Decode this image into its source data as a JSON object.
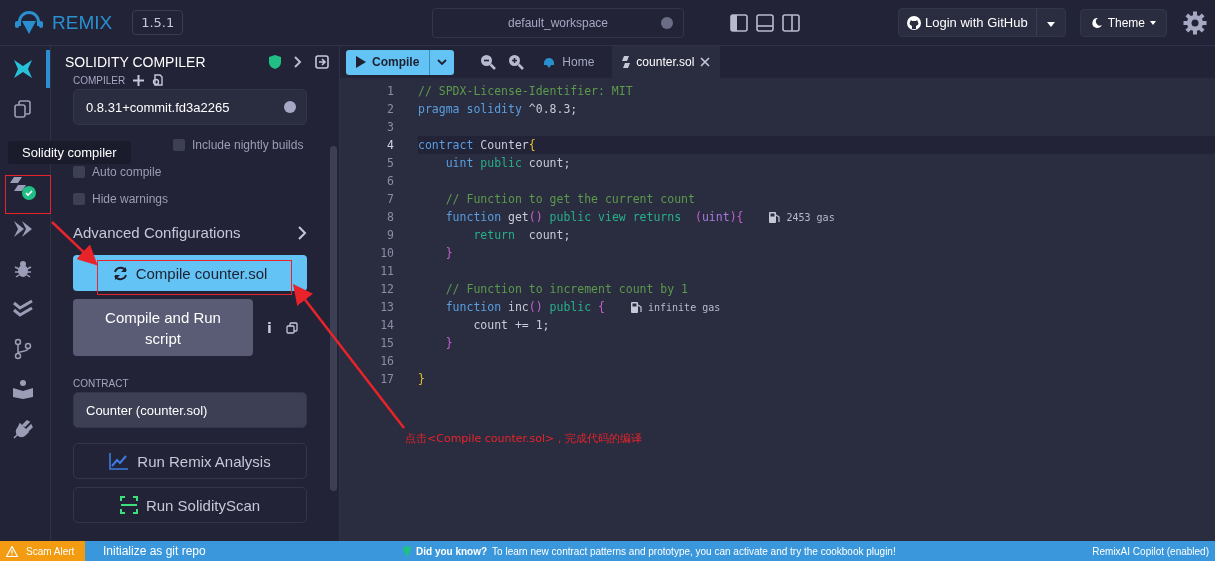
{
  "topbar": {
    "brand": "REMIX",
    "version": "1.5.1",
    "workspace": "default_workspace",
    "login": "Login with GitHub",
    "theme": "Theme"
  },
  "icon_rail": [
    {
      "kind": "ai",
      "selected": true
    },
    {
      "kind": "files",
      "selected": false
    },
    {
      "kind": "compiler",
      "selected": false,
      "compiled": true
    },
    {
      "kind": "deploy",
      "selected": false
    },
    {
      "kind": "debug",
      "selected": false
    },
    {
      "kind": "test",
      "selected": false
    },
    {
      "kind": "git",
      "selected": false
    },
    {
      "kind": "learn",
      "selected": false
    },
    {
      "kind": "plugin",
      "selected": false
    }
  ],
  "tooltip": "Solidity compiler",
  "panel": {
    "title": "SOLIDITY COMPILER",
    "compiler_label": "COMPILER",
    "compiler_version": "0.8.31+commit.fd3a2265",
    "options": [
      {
        "label": "Include nightly builds",
        "checked": false
      },
      {
        "label": "Auto compile",
        "checked": false
      },
      {
        "label": "Hide warnings",
        "checked": false
      }
    ],
    "advanced": "Advanced Configurations",
    "compile_button": "Compile counter.sol",
    "run_script_button": "Compile and Run script",
    "info": "i",
    "contract_label": "CONTRACT",
    "contract": "Counter (counter.sol)",
    "actions": [
      {
        "kind": "analysis",
        "label": "Run Remix Analysis"
      },
      {
        "kind": "scan",
        "label": "Run SolidityScan"
      }
    ]
  },
  "editor": {
    "compile": "Compile",
    "tabs": [
      {
        "kind": "home",
        "label": "Home",
        "selected": false
      },
      {
        "kind": "file",
        "label": "counter.sol",
        "selected": true
      }
    ],
    "lines": [
      {
        "number": "1",
        "current": false,
        "tokens": [
          {
            "kind": "comment",
            "text": "// SPDX-License-Identifier: MIT"
          }
        ]
      },
      {
        "number": "2",
        "current": false,
        "tokens": [
          {
            "kind": "keyword",
            "text": "pragma solidity"
          },
          {
            "kind": "plain",
            "text": " ^0.8.3;"
          }
        ]
      },
      {
        "number": "3",
        "current": false
      },
      {
        "number": "4",
        "current": true,
        "tokens": [
          {
            "kind": "keyword",
            "text": "contract"
          },
          {
            "kind": "plain",
            "text": " Counter"
          },
          {
            "kind": "brace1",
            "text": "{"
          }
        ]
      },
      {
        "number": "5",
        "current": false,
        "tokens": [
          {
            "kind": "keyword",
            "text": "    uint"
          },
          {
            "kind": "modifier",
            "text": " public"
          },
          {
            "kind": "plain",
            "text": " count;"
          }
        ]
      },
      {
        "number": "6",
        "current": false
      },
      {
        "number": "7",
        "current": false,
        "tokens": [
          {
            "kind": "comment",
            "text": "    // Function to get the current count"
          }
        ]
      },
      {
        "number": "8",
        "current": false,
        "tokens": [
          {
            "kind": "keyword",
            "text": "    function"
          },
          {
            "kind": "plain",
            "text": " get"
          },
          {
            "kind": "brace2",
            "text": "()"
          },
          {
            "kind": "modifier",
            "text": " public view returns"
          },
          {
            "kind": "brace2",
            "text": "  ("
          },
          {
            "kind": "type",
            "text": "uint"
          },
          {
            "kind": "brace2",
            "text": "){"
          }
        ],
        "gas": "2453 gas"
      },
      {
        "number": "9",
        "current": false,
        "tokens": [
          {
            "kind": "modifier",
            "text": "        return"
          },
          {
            "kind": "plain",
            "text": "  count;"
          }
        ]
      },
      {
        "number": "10",
        "current": false,
        "tokens": [
          {
            "kind": "brace2",
            "text": "    }"
          }
        ]
      },
      {
        "number": "11",
        "current": false
      },
      {
        "number": "12",
        "current": false,
        "tokens": [
          {
            "kind": "comment",
            "text": "    // Function to increment count by 1"
          }
        ]
      },
      {
        "number": "13",
        "current": false,
        "tokens": [
          {
            "kind": "keyword",
            "text": "    function"
          },
          {
            "kind": "plain",
            "text": " inc"
          },
          {
            "kind": "brace2",
            "text": "()"
          },
          {
            "kind": "modifier",
            "text": " public"
          },
          {
            "kind": "brace2",
            "text": " {"
          }
        ],
        "gas": "infinite gas"
      },
      {
        "number": "14",
        "current": false,
        "tokens": [
          {
            "kind": "plain",
            "text": "        count += 1;"
          }
        ]
      },
      {
        "number": "15",
        "current": false,
        "tokens": [
          {
            "kind": "brace2",
            "text": "    }"
          }
        ]
      },
      {
        "number": "16",
        "current": false
      },
      {
        "number": "17",
        "current": false,
        "tokens": [
          {
            "kind": "brace1",
            "text": "}"
          }
        ]
      }
    ]
  },
  "annotation": {
    "note": "点击<Compile counter.sol>，完成代码的编译"
  },
  "status_bar": {
    "scam": "Scam Alert",
    "git": "Initialize as git repo",
    "tip_title": "Did you know?",
    "tip": "To learn new contract patterns and prototype, you can activate and try the cookbook plugin!",
    "copilot": "RemixAI Copilot (enabled)"
  }
}
